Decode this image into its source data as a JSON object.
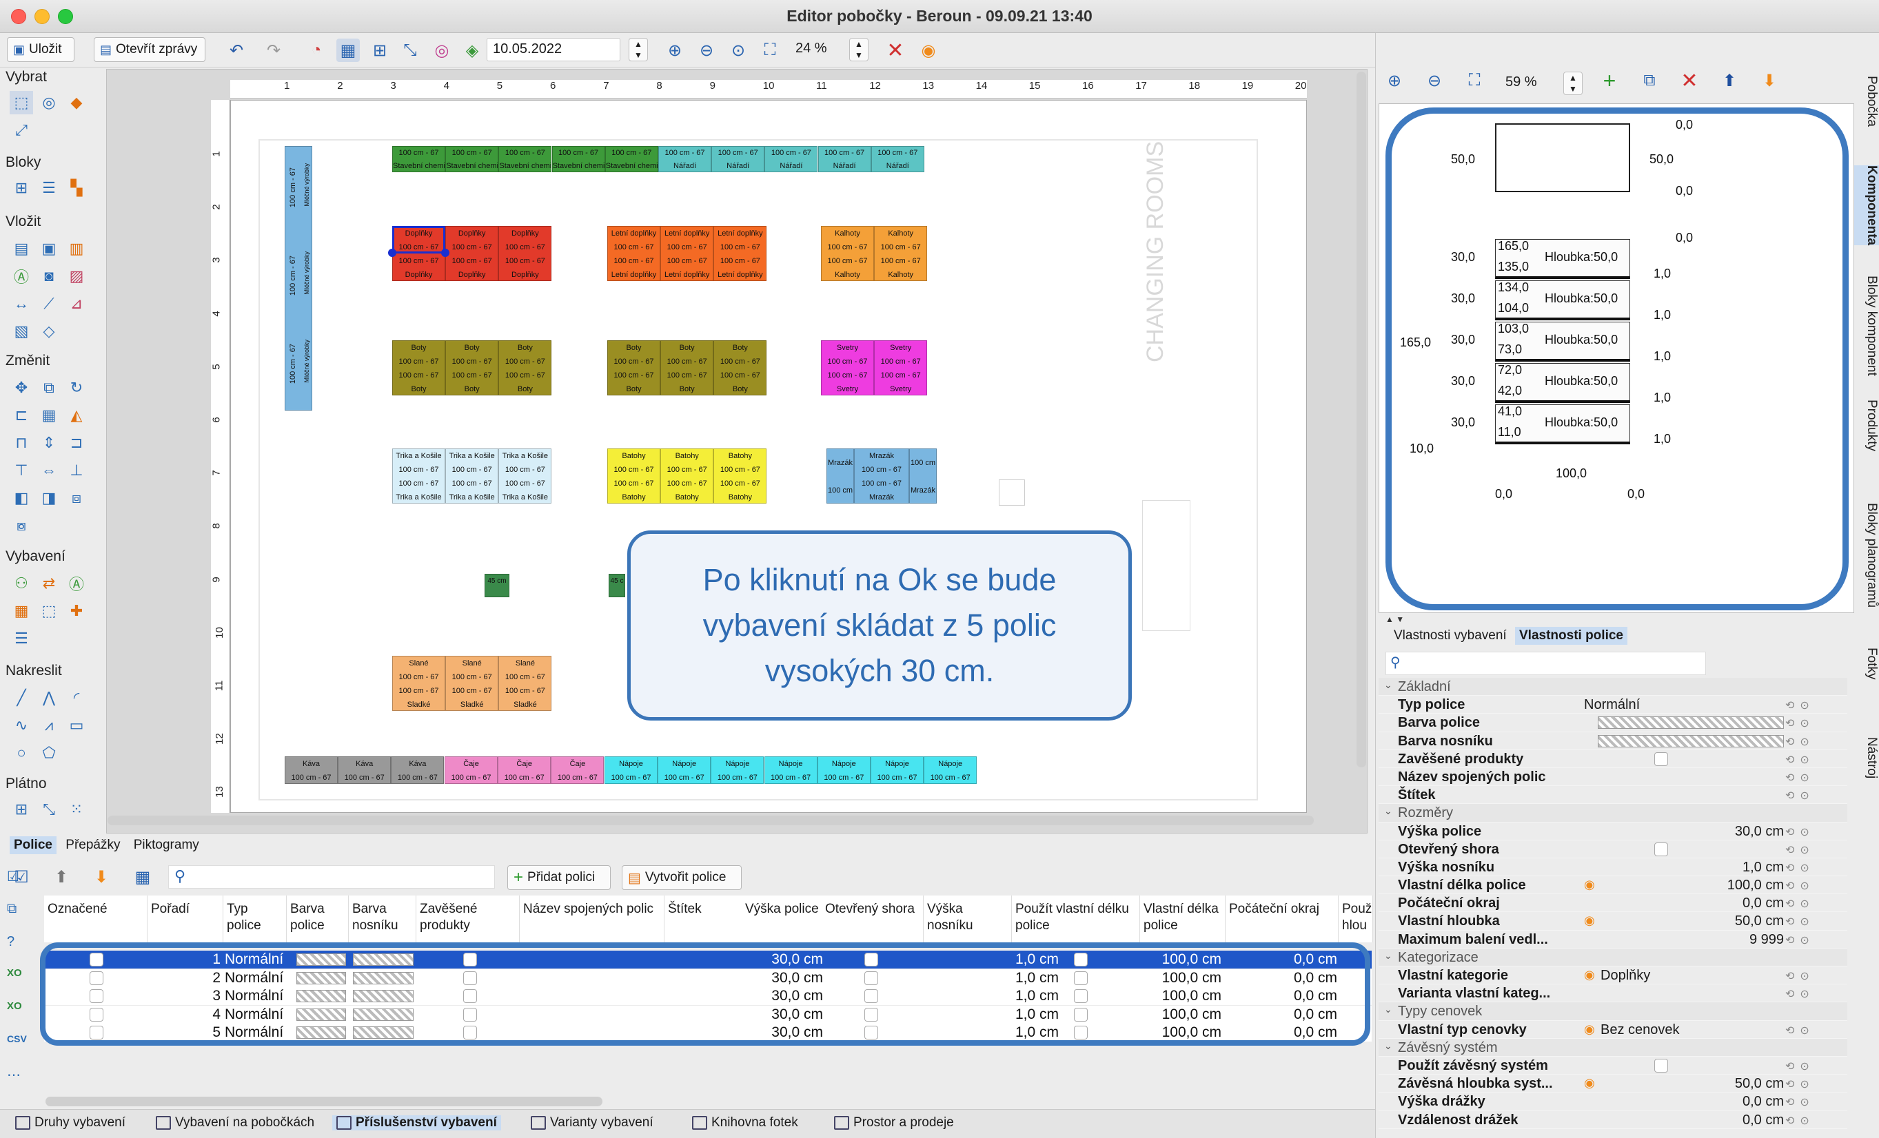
{
  "window": {
    "title": "Editor pobočky - Beroun - 09.09.21 13:40"
  },
  "toolbar": {
    "save_label": "Uložit",
    "open_reports_label": "Otevřít zprávy",
    "date_value": "10.05.2022",
    "zoom_value": "24 %"
  },
  "left_tools": {
    "groups": [
      "Vybrat",
      "Bloky",
      "Vložit",
      "Změnit",
      "Vybavení",
      "Nakreslit",
      "Plátno"
    ]
  },
  "ruler": {
    "top": [
      "1",
      "2",
      "3",
      "4",
      "5",
      "6",
      "7",
      "8",
      "9",
      "10",
      "11",
      "12",
      "13",
      "14",
      "15",
      "16",
      "17",
      "18",
      "19",
      "20"
    ],
    "left": [
      "1",
      "2",
      "3",
      "4",
      "5",
      "6",
      "7",
      "8",
      "9",
      "10",
      "11",
      "12",
      "13"
    ]
  },
  "floorplan": {
    "room_label": "CHANGING ROOMS",
    "small_45": "45 cm",
    "small_45b": "45 c",
    "shelves": {
      "dim": "100 cm - 67",
      "milk": "Mléčné výrobky",
      "drogerie": "Stavební chemie",
      "tools": "Nářadí",
      "dopl": "Doplňky",
      "letni": "Letní doplňky",
      "kalhoty": "Kalhoty",
      "boty": "Boty",
      "svetry": "Svetry",
      "trika": "Trika a Košile",
      "batohy": "Batohy",
      "mrazak": "Mrazák",
      "mrazak_dim": "100 cm",
      "slane": "Slané",
      "sladke": "Sladké",
      "kava": "Káva",
      "caje": "Čaje",
      "napoje": "Nápoje"
    }
  },
  "callout": {
    "text": "Po kliknutí na Ok se bude vybavení skládat z 5 polic vysokých 30 cm."
  },
  "preview": {
    "zoom": "59 %",
    "labels": {
      "a": "0,0",
      "b": "50,0",
      "c": "50,0",
      "d": "0,0",
      "e": "0,0",
      "s1t": "165,0",
      "s1b": "135,0",
      "s2t": "134,0",
      "s2b": "104,0",
      "s3t": "103,0",
      "s3b": "73,0",
      "s4t": "72,0",
      "s4b": "42,0",
      "s5t": "41,0",
      "s5b": "11,0",
      "depth": "Hloubka:50,0",
      "h": "30,0",
      "one": "1,0",
      "total": "165,0",
      "base": "10,0",
      "width": "100,0",
      "bl": "0,0",
      "br": "0,0"
    }
  },
  "vertical_tabs": [
    "Pobočka",
    "Komponenta",
    "Bloky komponent",
    "Produkty",
    "Bloky planogramů",
    "Fotky",
    "Nástroj"
  ],
  "property_tabs": {
    "equip": "Vlastnosti vybavení",
    "shelf": "Vlastnosti police"
  },
  "properties": [
    {
      "type": "section",
      "label": "Základní"
    },
    {
      "label": "Typ police",
      "value": "Normální"
    },
    {
      "label": "Barva police",
      "value": "",
      "pattern": true
    },
    {
      "label": "Barva nosníku",
      "value": "",
      "pattern": true
    },
    {
      "label": "Zavěšené produkty",
      "value": "",
      "check": true
    },
    {
      "label": "Název spojených polic",
      "value": ""
    },
    {
      "label": "Štítek",
      "value": ""
    },
    {
      "type": "section",
      "label": "Rozměry"
    },
    {
      "label": "Výška police",
      "value": "30,0 cm",
      "right": true
    },
    {
      "label": "Otevřený shora",
      "value": "",
      "check": true
    },
    {
      "label": "Výška nosníku",
      "value": "1,0 cm",
      "right": true
    },
    {
      "label": "Vlastní délka police",
      "value": "100,0 cm",
      "right": true,
      "mark": true
    },
    {
      "label": "Počáteční okraj",
      "value": "0,0 cm",
      "right": true
    },
    {
      "label": "Vlastní hloubka",
      "value": "50,0 cm",
      "right": true,
      "mark": true
    },
    {
      "label": "Maximum balení vedl...",
      "value": "9 999",
      "right": true
    },
    {
      "type": "section",
      "label": "Kategorizace"
    },
    {
      "label": "Vlastní kategorie",
      "value": "Doplňky",
      "mark": true
    },
    {
      "label": "Varianta vlastní kateg...",
      "value": ""
    },
    {
      "type": "section",
      "label": "Typy cenovek"
    },
    {
      "label": "Vlastní typ cenovky",
      "value": "Bez cenovek",
      "mark": true
    },
    {
      "type": "section",
      "label": "Závěsný systém"
    },
    {
      "label": "Použít závěsný systém",
      "value": "",
      "check": true
    },
    {
      "label": "Závěsná hloubka syst...",
      "value": "50,0 cm",
      "right": true,
      "mark": true
    },
    {
      "label": "Výška drážky",
      "value": "0,0 cm",
      "right": true
    },
    {
      "label": "Vzdálenost drážek",
      "value": "0,0 cm",
      "right": true
    }
  ],
  "bottom_tabs": [
    "Police",
    "Přepážky",
    "Piktogramy"
  ],
  "table_toolbar": {
    "add_shelf": "Přidat polici",
    "create_shelves": "Vytvořit police"
  },
  "table": {
    "headers": [
      "Označené",
      "Pořadí",
      "Typ police",
      "Barva police",
      "Barva nosníku",
      "Zavěšené produkty",
      "Název spojených polic",
      "Štítek",
      "Výška police",
      "Otevřený shora",
      "Výška nosníku",
      "Použít vlastní délku police",
      "Vlastní délka police",
      "Počáteční okraj",
      "Použ hlou"
    ],
    "rows": [
      {
        "order": "1",
        "type": "Normální",
        "height": "30,0 cm",
        "beam": "1,0 cm",
        "length": "100,0 cm",
        "margin": "0,0 cm"
      },
      {
        "order": "2",
        "type": "Normální",
        "height": "30,0 cm",
        "beam": "1,0 cm",
        "length": "100,0 cm",
        "margin": "0,0 cm"
      },
      {
        "order": "3",
        "type": "Normální",
        "height": "30,0 cm",
        "beam": "1,0 cm",
        "length": "100,0 cm",
        "margin": "0,0 cm"
      },
      {
        "order": "4",
        "type": "Normální",
        "height": "30,0 cm",
        "beam": "1,0 cm",
        "length": "100,0 cm",
        "margin": "0,0 cm"
      },
      {
        "order": "5",
        "type": "Normální",
        "height": "30,0 cm",
        "beam": "1,0 cm",
        "length": "100,0 cm",
        "margin": "0,0 cm"
      }
    ]
  },
  "status_tabs": [
    "Druhy vybavení",
    "Vybavení na pobočkách",
    "Příslušenství vybavení",
    "Varianty vybavení",
    "Knihovna fotek",
    "Prostor a prodeje"
  ],
  "colors": {
    "accent": "#3e7ac0",
    "selected_row": "#1f57c8",
    "callout_text": "#2e6bb2"
  }
}
